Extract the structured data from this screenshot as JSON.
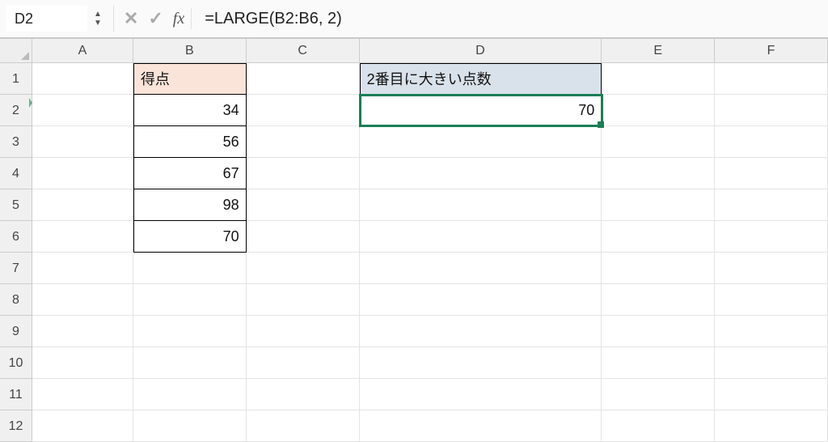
{
  "namebox": {
    "value": "D2"
  },
  "formula_bar": {
    "value": "=LARGE(B2:B6, 2)"
  },
  "columns": [
    "A",
    "B",
    "C",
    "D",
    "E",
    "F"
  ],
  "rows": [
    "1",
    "2",
    "3",
    "4",
    "5",
    "6",
    "7",
    "8",
    "9",
    "10",
    "11",
    "12"
  ],
  "cells": {
    "B1": {
      "text": "得点"
    },
    "D1": {
      "text": "2番目に大きい点数"
    },
    "B2": {
      "num": "34"
    },
    "B3": {
      "num": "56"
    },
    "B4": {
      "num": "67"
    },
    "B5": {
      "num": "98"
    },
    "B6": {
      "num": "70"
    },
    "D2": {
      "num": "70"
    }
  },
  "selected_cell": "D2",
  "chart_data": {
    "type": "table",
    "title": "得点 / 2番目に大きい点数",
    "columns": [
      "得点"
    ],
    "values": [
      34,
      56,
      67,
      98,
      70
    ],
    "derived": {
      "label": "2番目に大きい点数",
      "formula": "=LARGE(B2:B6, 2)",
      "result": 70
    }
  }
}
